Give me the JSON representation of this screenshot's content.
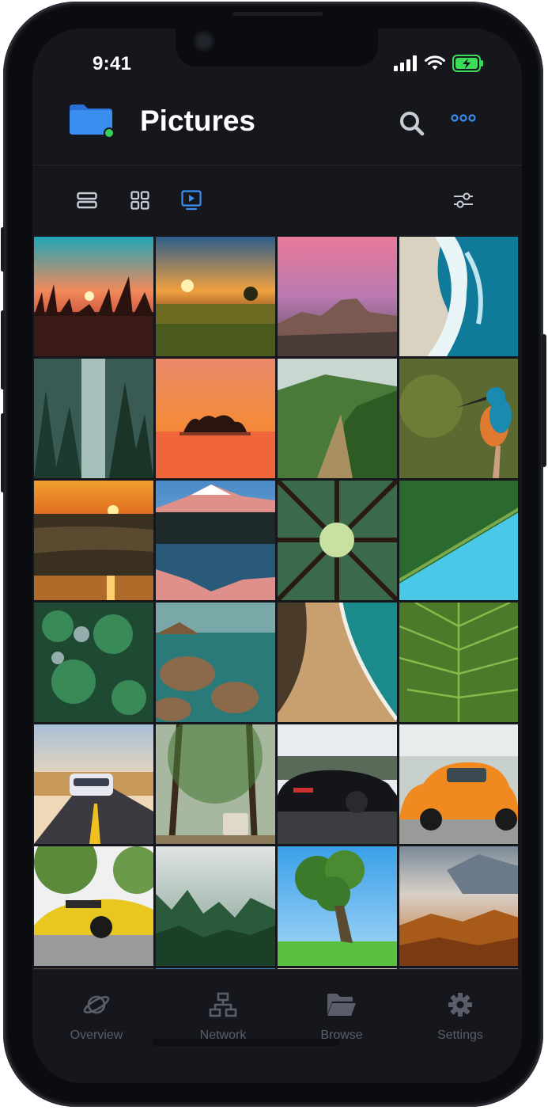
{
  "status_bar": {
    "time": "9:41"
  },
  "header": {
    "title": "Pictures",
    "folder_icon": "folder-icon",
    "accent": "#3a8ef0"
  },
  "toolbar": {
    "views": [
      "list-view-icon",
      "grid-view-icon",
      "slideshow-view-icon"
    ],
    "active_view": "slideshow-view-icon",
    "filter_icon": "sliders-icon"
  },
  "gallery": {
    "photos": [
      "sunset-grass",
      "sunset-meadow",
      "half-dome-pink-sky",
      "ocean-waves-aerial",
      "waterfall-forest",
      "orange-sunset-island",
      "green-mountain-ridge",
      "kingfisher-bird",
      "beach-sunset",
      "snowy-mountain-lake",
      "forest-canopy-looking-up",
      "forest-lake-aerial",
      "pine-trees-aerial",
      "rocky-coast-underwater",
      "sandy-beach-aerial",
      "green-leaf-closeup",
      "white-sports-car-road",
      "van-in-forest",
      "black-sedan",
      "orange-beetle-car",
      "yellow-lamborghini",
      "misty-pine-forest",
      "lone-tree-meadow",
      "autumn-mountain-fog"
    ]
  },
  "bottom_nav": {
    "items": [
      {
        "label": "Overview",
        "icon": "planet-icon"
      },
      {
        "label": "Network",
        "icon": "network-icon"
      },
      {
        "label": "Browse",
        "icon": "folder-open-icon"
      },
      {
        "label": "Settings",
        "icon": "gear-icon"
      }
    ]
  },
  "colors": {
    "background": "#16171d",
    "text_primary": "#ffffff",
    "nav_inactive": "#5a5e6a",
    "battery": "#3ddc57"
  }
}
